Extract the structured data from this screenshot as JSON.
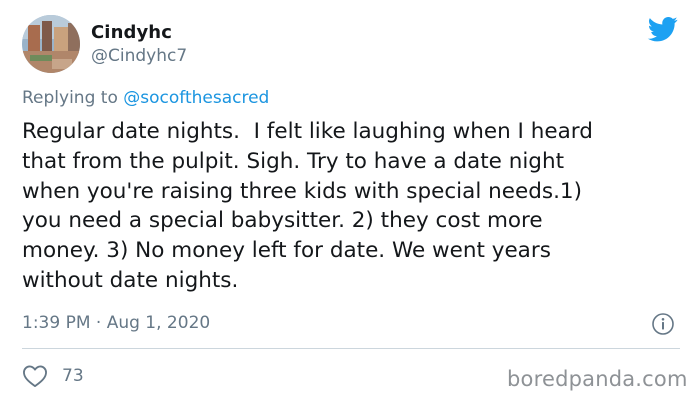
{
  "author": {
    "display_name": "Cindyhc",
    "handle": "@Cindyhc7"
  },
  "reply": {
    "prefix": "Replying to ",
    "mention": "@socofthesacred"
  },
  "tweet": {
    "text": "Regular date nights.  I felt like laughing when I heard\nthat from the pulpit. Sigh. Try to have a date night\nwhen you're raising three kids with special needs.1)\nyou need a special babysitter. 2) they cost more\nmoney. 3) No money left for date. We went years\nwithout date nights.",
    "timestamp": "1:39 PM · Aug 1, 2020"
  },
  "stats": {
    "likes": "73"
  },
  "watermark": "boredpanda.com",
  "icons": {
    "brand": "twitter-bird-icon",
    "info": "info-icon",
    "like": "heart-icon"
  },
  "colors": {
    "brand_blue": "#1da1f2",
    "mention_blue": "#1b95e0",
    "secondary_text": "#657786",
    "primary_text": "#14171a"
  }
}
